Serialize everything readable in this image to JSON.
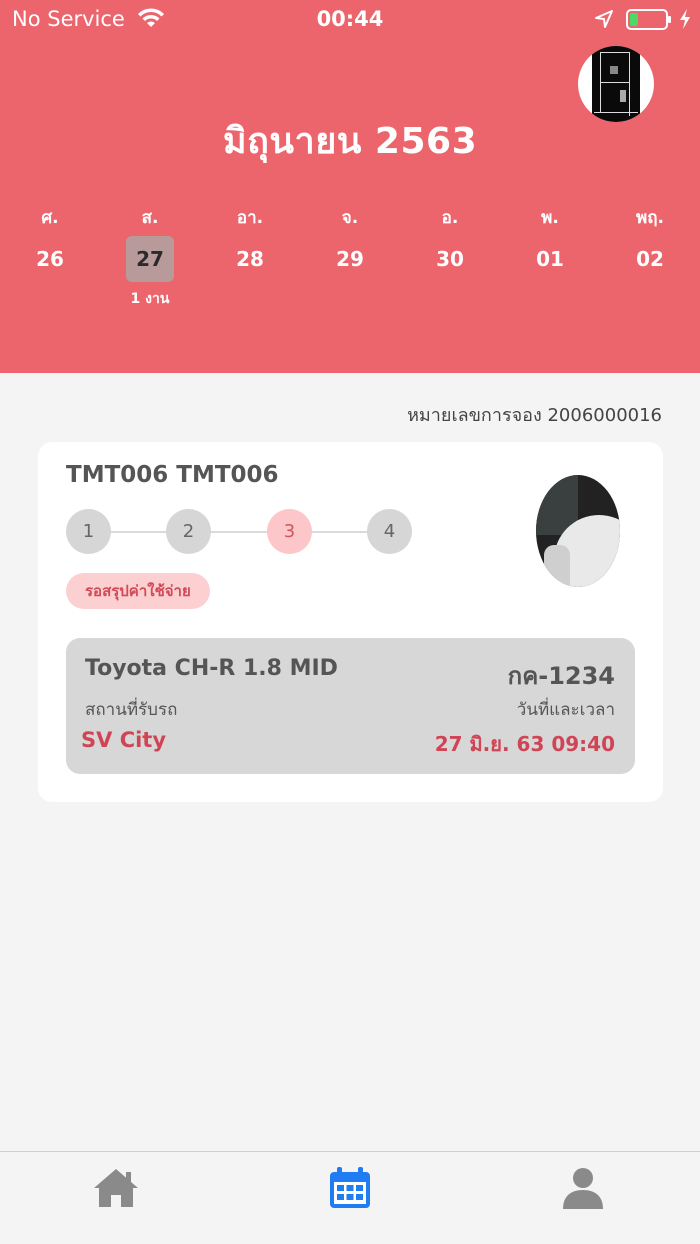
{
  "status_bar": {
    "carrier": "No Service",
    "time": "00:44",
    "battery_color": "#4cd964"
  },
  "header": {
    "month_title": "มิถุนายน 2563",
    "bg_color": "#ec646c",
    "days": [
      {
        "name": "ศ.",
        "num": "26",
        "count": ""
      },
      {
        "name": "ส.",
        "num": "27",
        "count": "1 งาน",
        "selected": true
      },
      {
        "name": "อา.",
        "num": "28",
        "count": ""
      },
      {
        "name": "จ.",
        "num": "29",
        "count": ""
      },
      {
        "name": "อ.",
        "num": "30",
        "count": ""
      },
      {
        "name": "พ.",
        "num": "01",
        "count": ""
      },
      {
        "name": "พฤ.",
        "num": "02",
        "count": ""
      }
    ]
  },
  "booking": {
    "booking_number": "หมายเลขการจอง 2006000016",
    "title": "TMT006 TMT006",
    "steps": [
      "1",
      "2",
      "3",
      "4"
    ],
    "active_step": 3,
    "status_badge": "รอสรุปค่าใช้จ่าย",
    "car": {
      "model": "Toyota CH-R 1.8  MID",
      "plate": "กค-1234",
      "pickup_label": "สถานที่รับรถ",
      "datetime_label": "วันที่และเวลา",
      "pickup_value": "SV City",
      "datetime_value": "27 มิ.ย. 63 09:40"
    }
  },
  "tabbar": {
    "tabs": [
      {
        "icon": "home-icon",
        "color": "#8a8a8a"
      },
      {
        "icon": "calendar-icon",
        "color": "#1f7cf2",
        "active": true
      },
      {
        "icon": "user-icon",
        "color": "#8a8a8a"
      }
    ]
  }
}
